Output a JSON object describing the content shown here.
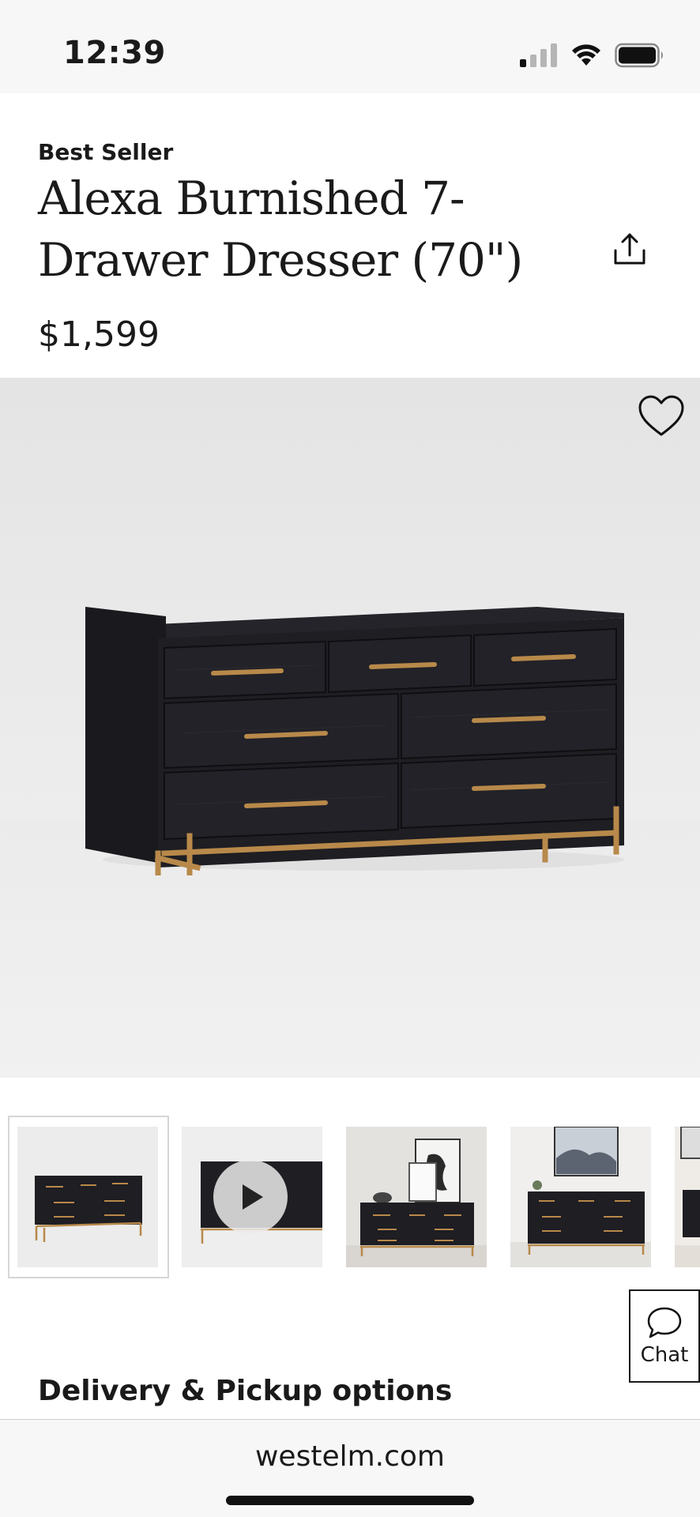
{
  "status_bar": {
    "time": "12:39",
    "icons": [
      "signal-icon",
      "wifi-icon",
      "battery-icon"
    ]
  },
  "product": {
    "badge": "Best Seller",
    "title": "Alexa Burnished 7-Drawer Dresser (70\")",
    "price": "$1,599",
    "image_alt": "Alexa Burnished 7-Drawer Dresser in black with brass handles and base"
  },
  "actions": {
    "share_icon": "share-icon",
    "favorite_icon": "heart-icon"
  },
  "thumbnails": [
    {
      "type": "image",
      "selected": true
    },
    {
      "type": "video",
      "selected": false,
      "icon": "play-icon"
    },
    {
      "type": "image",
      "selected": false
    },
    {
      "type": "image",
      "selected": false
    },
    {
      "type": "image",
      "selected": false
    }
  ],
  "chat": {
    "label": "Chat",
    "icon": "chat-bubble-icon"
  },
  "sections": {
    "delivery_heading": "Delivery & Pickup options"
  },
  "browser": {
    "url": "westelm.com"
  },
  "colors": {
    "brass": "#b8894a",
    "dresser": "#1c1c20",
    "text": "#1a1a1a"
  }
}
